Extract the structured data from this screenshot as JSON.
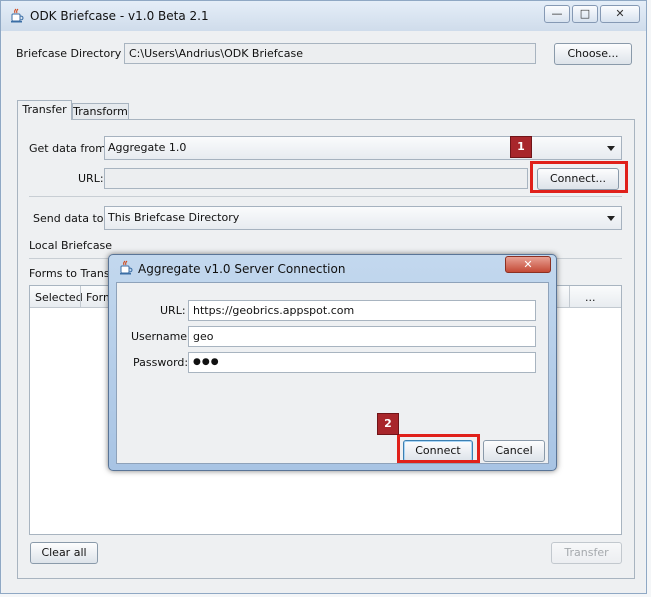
{
  "window": {
    "title": "ODK Briefcase - v1.0 Beta 2.1",
    "minimize_glyph": "—",
    "maximize_glyph": "□",
    "close_glyph": "✕"
  },
  "briefcase": {
    "label": "Briefcase Directory",
    "path": "C:\\Users\\Andrius\\ODK Briefcase",
    "choose_button": "Choose..."
  },
  "tabs": [
    {
      "label": "Transfer",
      "active": true
    },
    {
      "label": "Transform",
      "active": false
    }
  ],
  "transfer": {
    "get_label": "Get data from:",
    "get_value": "Aggregate 1.0",
    "url_label": "URL:",
    "url_value": "",
    "connect_button": "Connect...",
    "send_label": "Send data to:",
    "send_value": "This Briefcase Directory",
    "local_briefcase": "Local Briefcase",
    "forms_label": "Forms to Transfer",
    "columns": [
      "Selected",
      "Form Name",
      "..."
    ],
    "clear_all": "Clear all",
    "transfer_button": "Transfer"
  },
  "dialog": {
    "title": "Aggregate v1.0 Server Connection",
    "close_glyph": "✕",
    "url_label": "URL:",
    "url_value": "https://geobrics.appspot.com",
    "username_label": "Username:",
    "username_value": "geo",
    "password_label": "Password:",
    "password_value": "●●●",
    "connect_button": "Connect",
    "cancel_button": "Cancel"
  },
  "annotations": {
    "step1": "1",
    "step2": "2",
    "color": "#e0201a",
    "badge_color": "#a8262b"
  },
  "icons": {
    "app": "java-cup-icon"
  }
}
